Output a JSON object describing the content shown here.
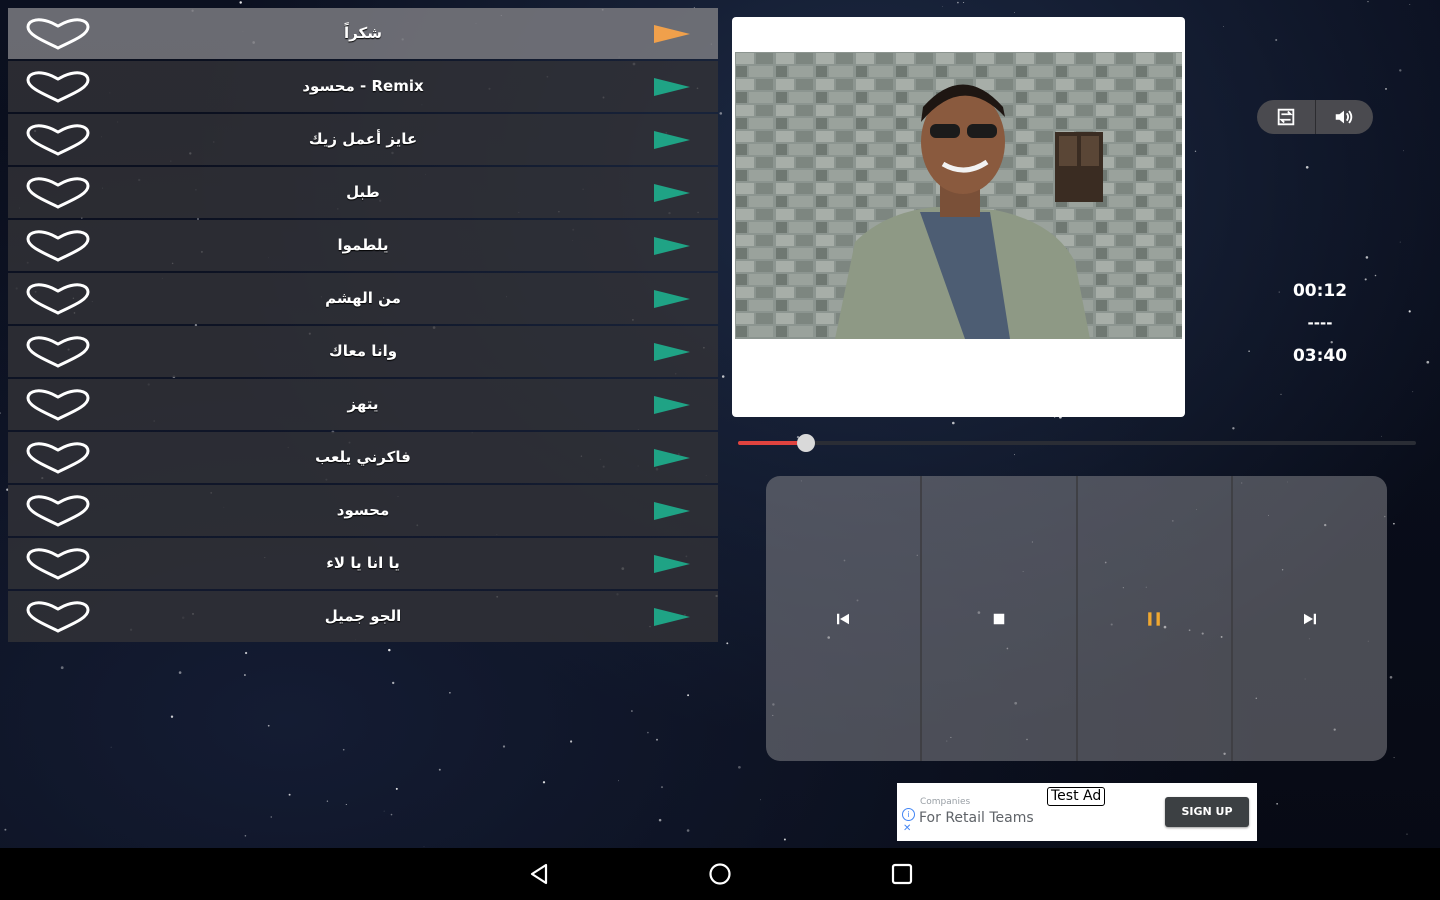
{
  "playlist": {
    "items": [
      {
        "title": "شكراً",
        "active": true
      },
      {
        "title": "محسود - Remix",
        "active": false
      },
      {
        "title": "عايز أعمل زيك",
        "active": false
      },
      {
        "title": "طبل",
        "active": false
      },
      {
        "title": "يلطموا",
        "active": false
      },
      {
        "title": "من الهشم",
        "active": false
      },
      {
        "title": "وانا معاك",
        "active": false
      },
      {
        "title": "يتهز",
        "active": false
      },
      {
        "title": "فاكرني يلعب",
        "active": false
      },
      {
        "title": "محسود",
        "active": false
      },
      {
        "title": "يا انا يا لاء",
        "active": false
      },
      {
        "title": "الجو جميل",
        "active": false
      }
    ],
    "heart_icon": "heart-outline-icon",
    "play_icon": "play-triangle-icon"
  },
  "colors": {
    "play_active": "#f0a04b",
    "play_inactive": "#1fa385",
    "seek_fill": "#e0433f",
    "pause_icon": "#f0a830"
  },
  "player": {
    "current_time": "00:12",
    "separator": "----",
    "total_time": "03:40",
    "progress": 0.056,
    "toggles": [
      "repeat-icon",
      "volume-icon"
    ],
    "controls": [
      "skip-previous-icon",
      "stop-icon",
      "pause-icon",
      "skip-next-icon"
    ]
  },
  "ad": {
    "brand": "Companies",
    "text": "For Retail Teams",
    "badge": "Test Ad",
    "cta": "SIGN UP"
  },
  "navbar": [
    "back-icon",
    "home-icon",
    "recents-icon"
  ]
}
